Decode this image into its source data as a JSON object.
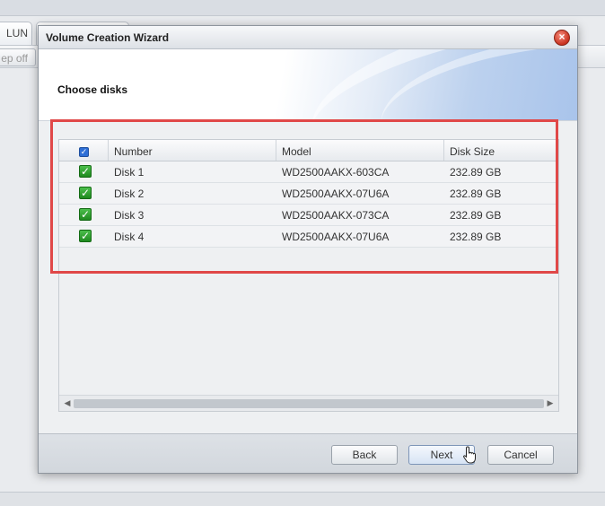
{
  "background": {
    "tabs": [
      {
        "label": "LUN"
      },
      {
        "label": ""
      }
    ],
    "toolbar_button": "ep off"
  },
  "modal": {
    "title": "Volume Creation Wizard",
    "heading": "Choose disks",
    "close_icon": "close-icon"
  },
  "grid": {
    "columns": [
      "Number",
      "Model",
      "Disk Size"
    ],
    "rows": [
      {
        "number": "Disk 1",
        "model": "WD2500AAKX-603CA",
        "size": "232.89 GB",
        "checked": true
      },
      {
        "number": "Disk 2",
        "model": "WD2500AAKX-07U6A",
        "size": "232.89 GB",
        "checked": true
      },
      {
        "number": "Disk 3",
        "model": "WD2500AAKX-073CA",
        "size": "232.89 GB",
        "checked": true
      },
      {
        "number": "Disk 4",
        "model": "WD2500AAKX-07U6A",
        "size": "232.89 GB",
        "checked": true
      }
    ],
    "select_all_checked": true
  },
  "footer": {
    "back_label": "Back",
    "next_label": "Next",
    "cancel_label": "Cancel"
  },
  "colors": {
    "highlight": "#e04848",
    "check_green": "#2a9a2a",
    "header_check_blue": "#2f6fd6"
  }
}
